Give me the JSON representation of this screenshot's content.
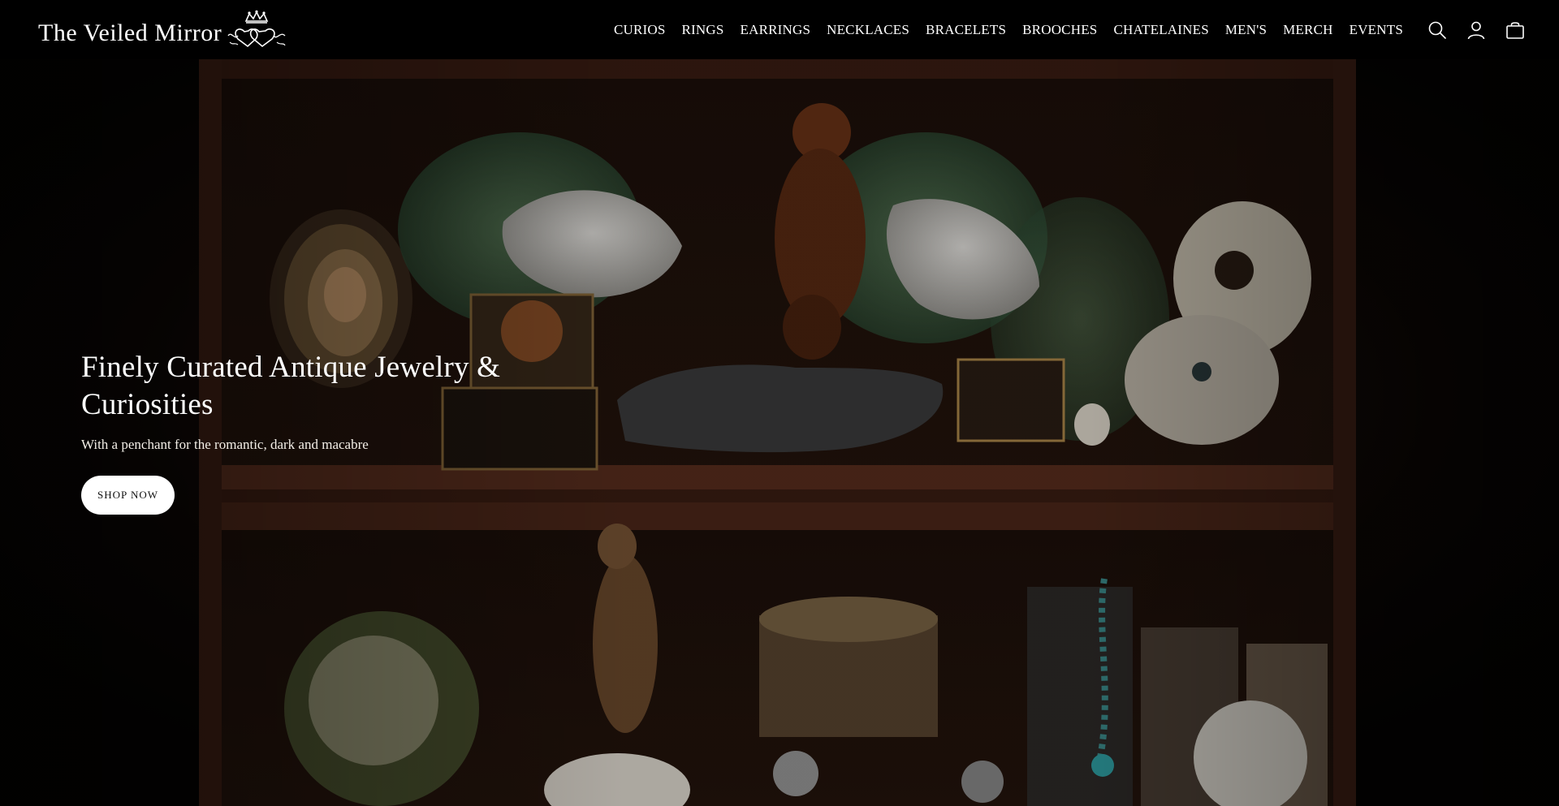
{
  "header": {
    "logo_text": "The Veiled Mirror",
    "nav": [
      {
        "label": "CURIOS"
      },
      {
        "label": "RINGS"
      },
      {
        "label": "EARRINGS"
      },
      {
        "label": "NECKLACES"
      },
      {
        "label": "BRACELETS"
      },
      {
        "label": "BROOCHES"
      },
      {
        "label": "CHATELAINES"
      },
      {
        "label": "MEN'S"
      },
      {
        "label": "MERCH"
      },
      {
        "label": "EVENTS"
      }
    ],
    "icons": {
      "search": "search-icon",
      "account": "user-icon",
      "cart": "bag-icon"
    }
  },
  "hero": {
    "title": "Finely Curated Antique Jewelry & Curiosities",
    "subtitle": "With a penchant for the romantic, dark and macabre",
    "cta_label": "SHOP NOW",
    "image": "cabinet-of-curiosities-photo"
  },
  "colors": {
    "header_bg": "#000000",
    "text": "#ffffff",
    "cta_bg": "#ffffff",
    "cta_text": "#111111"
  }
}
